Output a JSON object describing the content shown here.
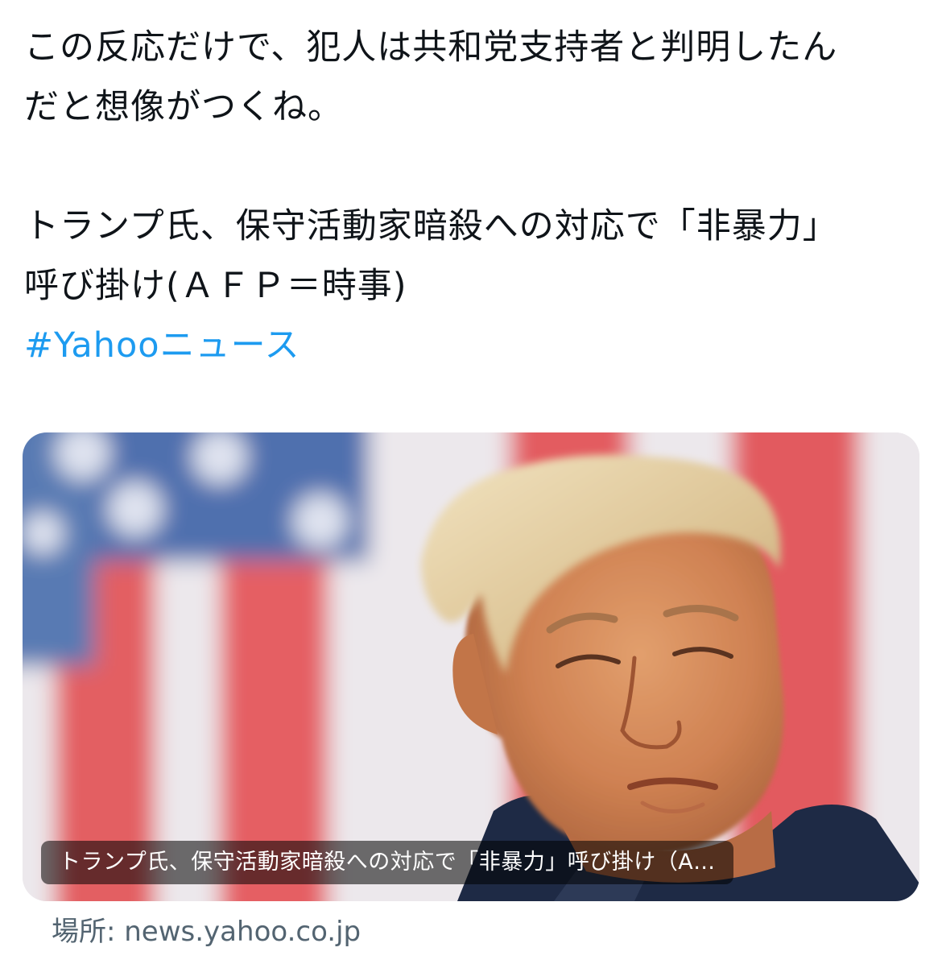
{
  "tweet": {
    "lines": [
      "この反応だけで、犯人は共和党支持者と判明したん",
      "だと想像がつくね。",
      "トランプ氏、保守活動家暗殺への対応で「非暴力」",
      "呼び掛け(ＡＦＰ＝時事)"
    ],
    "hashtag": "#Yahooニュース"
  },
  "link_card": {
    "caption": "トランプ氏、保守活動家暗殺への対応で「非暴力」呼び掛け（A…",
    "image_icon": "news-photo-image"
  },
  "source": {
    "label": "場所: news.yahoo.co.jp"
  },
  "colors": {
    "text": "#0f1419",
    "hashtag": "#1d9bf0",
    "secondary": "#536471"
  }
}
